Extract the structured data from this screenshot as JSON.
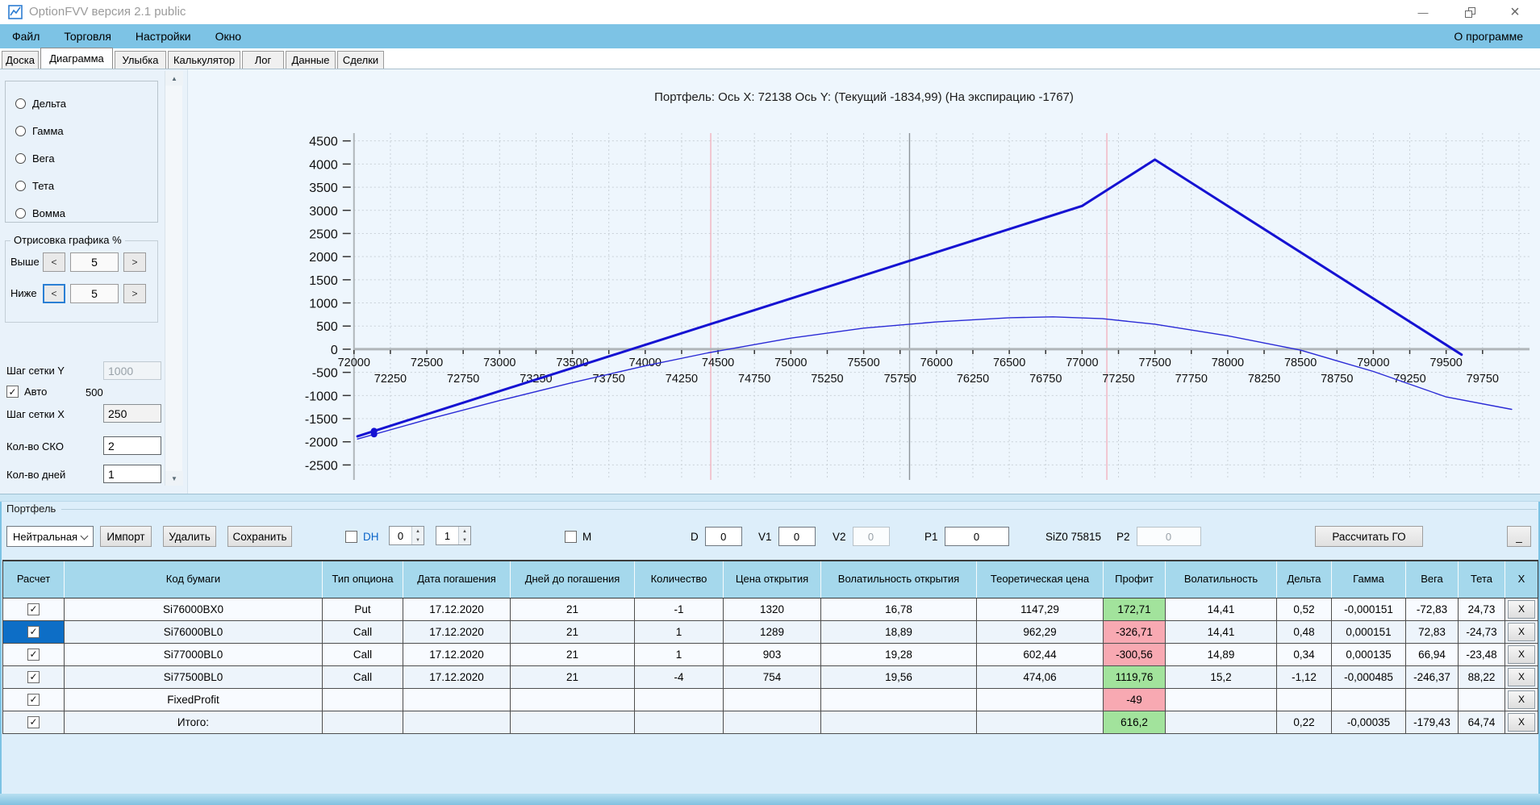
{
  "window": {
    "title": "OptionFVV версия 2.1 public"
  },
  "menu": {
    "items": [
      "Файл",
      "Торговля",
      "Настройки",
      "Окно"
    ],
    "right": "О программе"
  },
  "tabs": {
    "items": [
      "Доска",
      "Диаграмма",
      "Улыбка",
      "Калькулятор",
      "Лог",
      "Данные",
      "Сделки"
    ],
    "active": "Диаграмма"
  },
  "sidebar": {
    "greeks": [
      "Дельта",
      "Гамма",
      "Вега",
      "Тета",
      "Вомма"
    ],
    "draw_group": {
      "label": "Отрисовка графика %",
      "dec": "<",
      "inc": ">",
      "rows": [
        {
          "label": "Выше",
          "value": "5"
        },
        {
          "label": "Ниже",
          "value": "5"
        }
      ]
    },
    "grid_y": {
      "label": "Шаг сетки Y",
      "value": "1000"
    },
    "auto": {
      "label": "Авто",
      "checked": true,
      "computed": "500"
    },
    "grid_x": {
      "label": "Шаг сетки X",
      "value": "250"
    },
    "sko": {
      "label": "Кол-во СКО",
      "value": "2"
    },
    "days": {
      "label": "Кол-во дней",
      "value": "1"
    }
  },
  "chart_data": {
    "type": "line",
    "title": "Портфель: Ось X: 72138 Ось Y:  (Текущий -1834,99)  (На экспирацию -1767)",
    "x_range": [
      70860,
      80150
    ],
    "y_range": [
      -3120,
      6045
    ],
    "xlabel": "",
    "ylabel": "",
    "grid": true,
    "grid_x_step": 250,
    "grid_y_step": 500,
    "y_ticks": [
      -2500,
      -2000,
      -1500,
      -1000,
      -500,
      0,
      500,
      1000,
      1500,
      2000,
      2500,
      3000,
      3500,
      4000,
      4500
    ],
    "x_ticks_row1": [
      72000,
      72500,
      73000,
      73500,
      74000,
      74500,
      75000,
      75500,
      76000,
      76500,
      77000,
      77500,
      78000,
      78500,
      79000,
      79500
    ],
    "x_ticks_row2": [
      72250,
      72750,
      73250,
      73750,
      74250,
      74750,
      75250,
      75750,
      76250,
      76750,
      77250,
      77750,
      78250,
      78750,
      79250,
      79750
    ],
    "vlines": [
      {
        "x": 74450,
        "color": "#f2b3bf",
        "name": "sko-band-lower"
      },
      {
        "x": 77170,
        "color": "#f2b3bf",
        "name": "sko-band-upper"
      },
      {
        "x": 75815,
        "color": "#8d9399",
        "name": "current-price-line"
      }
    ],
    "series": [
      {
        "name": "На экспирацию",
        "color": "#1512d2",
        "width": 3,
        "points": [
          [
            72024,
            -1881
          ],
          [
            76000,
            2095
          ],
          [
            77000,
            3095
          ],
          [
            77500,
            4095
          ],
          [
            79606,
            -117
          ]
        ]
      },
      {
        "name": "Текущий",
        "color": "#2a2ad6",
        "width": 1.4,
        "points": [
          [
            72024,
            -1940
          ],
          [
            72500,
            -1520
          ],
          [
            73000,
            -1110
          ],
          [
            73500,
            -720
          ],
          [
            74000,
            -360
          ],
          [
            74430,
            -80
          ],
          [
            75000,
            240
          ],
          [
            75500,
            455
          ],
          [
            76000,
            590
          ],
          [
            76500,
            680
          ],
          [
            76800,
            700
          ],
          [
            77140,
            660
          ],
          [
            77500,
            540
          ],
          [
            78000,
            290
          ],
          [
            78500,
            -20
          ],
          [
            79000,
            -480
          ],
          [
            79500,
            -1030
          ],
          [
            79950,
            -1300
          ]
        ]
      }
    ],
    "markers": [
      {
        "x": 72138,
        "y": -1834.99,
        "series": "Текущий"
      },
      {
        "x": 72138,
        "y": -1767,
        "series": "На экспирацию"
      }
    ],
    "cursor": {
      "x": 72138,
      "current": "-1834,99",
      "expiration": "-1767"
    }
  },
  "portfolio": {
    "group_label": "Портфель",
    "toolbar": {
      "strategy": "Нейтральная",
      "buttons": [
        "Импорт",
        "Удалить",
        "Сохранить"
      ],
      "dh": {
        "label": "DH",
        "checked": false
      },
      "spin1": "0",
      "spin2": "1",
      "m": {
        "label": "М",
        "checked": false
      },
      "fields": [
        {
          "label": "D",
          "value": "0",
          "disabled": false
        },
        {
          "label": "V1",
          "value": "0",
          "disabled": false
        },
        {
          "label": "V2",
          "value": "0",
          "disabled": true
        },
        {
          "label": "P1",
          "value": "0",
          "disabled": false
        },
        {
          "label": "P2",
          "value": "0",
          "disabled": true
        }
      ],
      "instrument": "SiZ0 75815",
      "calc_button": "Рассчитать ГО",
      "min_button": "_"
    },
    "table": {
      "columns": [
        "Расчет",
        "Код бумаги",
        "Тип опциона",
        "Дата погашения",
        "Дней до погашения",
        "Количество",
        "Цена открытия",
        "Волатильность открытия",
        "Теоретическая цена",
        "Профит",
        "Волатильность",
        "Дельта",
        "Гамма",
        "Вега",
        "Тета",
        "X"
      ],
      "x_button": "X",
      "rows": [
        {
          "checked": true,
          "selected": false,
          "code": "Si76000BX0",
          "type": "Put",
          "expiry": "17.12.2020",
          "days": "21",
          "qty": "-1",
          "open_price": "1320",
          "open_vol": "16,78",
          "theor_price": "1147,29",
          "profit": "172,71",
          "profit_sign": "pos",
          "vol": "14,41",
          "delta": "0,52",
          "gamma": "-0,000151",
          "vega": "-72,83",
          "theta": "24,73"
        },
        {
          "checked": true,
          "selected": true,
          "code": "Si76000BL0",
          "type": "Call",
          "expiry": "17.12.2020",
          "days": "21",
          "qty": "1",
          "open_price": "1289",
          "open_vol": "18,89",
          "theor_price": "962,29",
          "profit": "-326,71",
          "profit_sign": "neg",
          "vol": "14,41",
          "delta": "0,48",
          "gamma": "0,000151",
          "vega": "72,83",
          "theta": "-24,73"
        },
        {
          "checked": true,
          "selected": false,
          "code": "Si77000BL0",
          "type": "Call",
          "expiry": "17.12.2020",
          "days": "21",
          "qty": "1",
          "open_price": "903",
          "open_vol": "19,28",
          "theor_price": "602,44",
          "profit": "-300,56",
          "profit_sign": "neg",
          "vol": "14,89",
          "delta": "0,34",
          "gamma": "0,000135",
          "vega": "66,94",
          "theta": "-23,48"
        },
        {
          "checked": true,
          "selected": false,
          "code": "Si77500BL0",
          "type": "Call",
          "expiry": "17.12.2020",
          "days": "21",
          "qty": "-4",
          "open_price": "754",
          "open_vol": "19,56",
          "theor_price": "474,06",
          "profit": "1119,76",
          "profit_sign": "pos",
          "vol": "15,2",
          "delta": "-1,12",
          "gamma": "-0,000485",
          "vega": "-246,37",
          "theta": "88,22"
        },
        {
          "checked": true,
          "selected": false,
          "code": "FixedProfit",
          "type": "",
          "expiry": "",
          "days": "",
          "qty": "",
          "open_price": "",
          "open_vol": "",
          "theor_price": "",
          "profit": "-49",
          "profit_sign": "neg",
          "vol": "",
          "delta": "",
          "gamma": "",
          "vega": "",
          "theta": ""
        },
        {
          "checked": true,
          "selected": false,
          "total": true,
          "code": "Итого:",
          "type": "",
          "expiry": "",
          "days": "",
          "qty": "",
          "open_price": "",
          "open_vol": "",
          "theor_price": "",
          "profit": "616,2",
          "profit_sign": "pos",
          "vol": "",
          "delta": "0,22",
          "gamma": "-0,00035",
          "vega": "-179,43",
          "theta": "64,74"
        }
      ]
    }
  }
}
